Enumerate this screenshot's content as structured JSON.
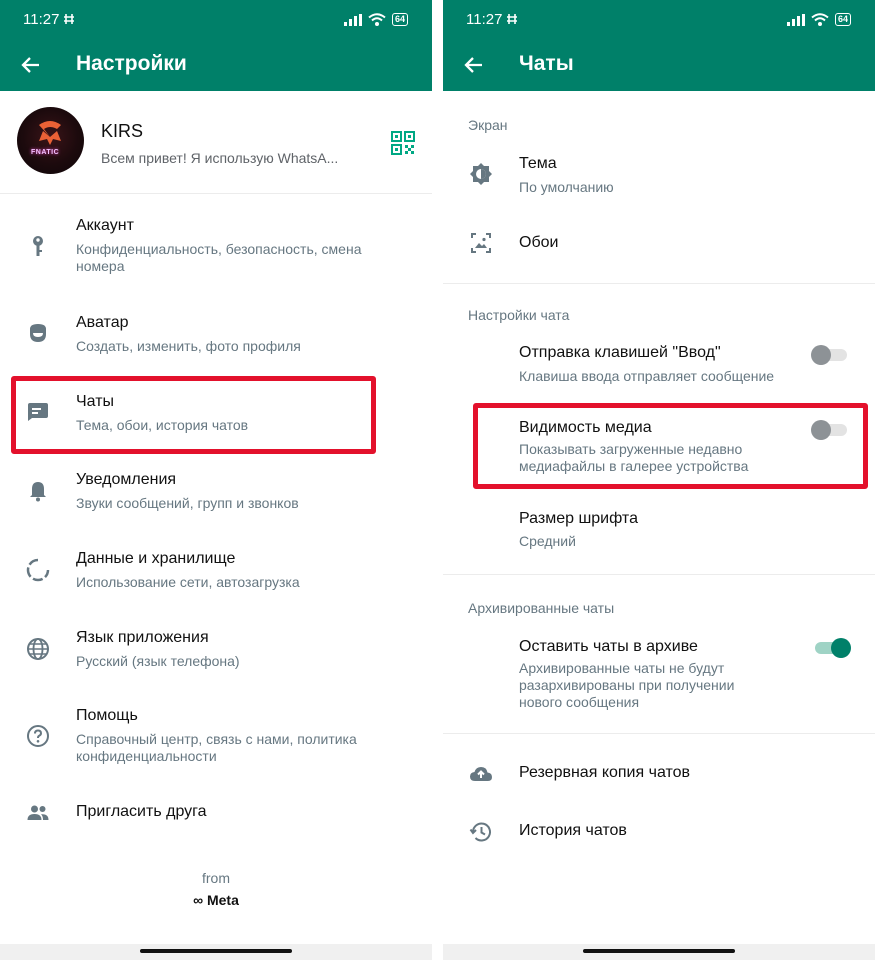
{
  "left": {
    "status_time": "11:27",
    "battery": "64",
    "title": "Настройки",
    "profile": {
      "name": "KIRS",
      "status": "Всем привет! Я использую WhatsA...",
      "avatar_text": "FNATIC"
    },
    "items": [
      {
        "title": "Аккаунт",
        "subtitle": "Конфиденциальность, безопасность, смена номера",
        "icon": "key-icon"
      },
      {
        "title": "Аватар",
        "subtitle": "Создать, изменить, фото профиля",
        "icon": "avatar-face-icon"
      },
      {
        "title": "Чаты",
        "subtitle": "Тема, обои, история чатов",
        "icon": "chat-icon"
      },
      {
        "title": "Уведомления",
        "subtitle": "Звуки сообщений, групп и звонков",
        "icon": "bell-icon"
      },
      {
        "title": "Данные и хранилище",
        "subtitle": "Использование сети, автозагрузка",
        "icon": "storage-circle-icon"
      },
      {
        "title": "Язык приложения",
        "subtitle": "Русский (язык телефона)",
        "icon": "globe-icon"
      },
      {
        "title": "Помощь",
        "subtitle": "Справочный центр, связь с нами, политика конфиденциальности",
        "icon": "help-icon"
      },
      {
        "title": "Пригласить друга",
        "subtitle": "",
        "icon": "people-icon"
      }
    ],
    "from_label": "from",
    "meta_label": "Meta"
  },
  "right": {
    "status_time": "11:27",
    "battery": "64",
    "title": "Чаты",
    "sections": {
      "screen": "Экран",
      "chat_settings": "Настройки чата",
      "archived": "Архивированные чаты"
    },
    "theme": {
      "title": "Тема",
      "subtitle": "По умолчанию"
    },
    "wallpaper": {
      "title": "Обои"
    },
    "enter_send": {
      "title": "Отправка клавишей \"Ввод\"",
      "subtitle": "Клавиша ввода отправляет сообщение",
      "enabled": false
    },
    "media_visibility": {
      "title": "Видимость медиа",
      "subtitle": "Показывать загруженные недавно медиафайлы в галерее устройства",
      "enabled": false
    },
    "font_size": {
      "title": "Размер шрифта",
      "subtitle": "Средний"
    },
    "keep_archived": {
      "title": "Оставить чаты в архиве",
      "subtitle": "Архивированные чаты не будут разархивированы при получении нового сообщения",
      "enabled": true
    },
    "backup": {
      "title": "Резервная копия чатов"
    },
    "history": {
      "title": "История чатов"
    }
  },
  "colors": {
    "header": "#008069",
    "highlight": "#e3112c",
    "toggle_on": "#008069",
    "toggle_off": "#8d9296"
  }
}
